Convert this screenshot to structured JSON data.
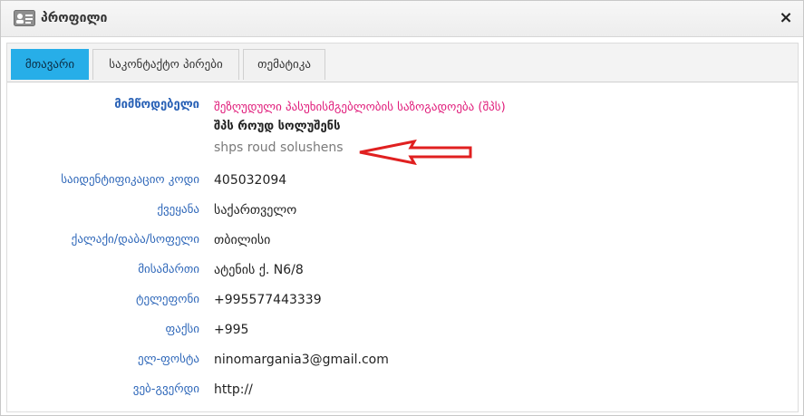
{
  "window": {
    "title": "პროფილი",
    "close": "×"
  },
  "tabs": [
    {
      "label": "მთავარი",
      "active": true
    },
    {
      "label": "საკონტაქტო პირები",
      "active": false
    },
    {
      "label": "თემატიკა",
      "active": false
    }
  ],
  "supplier": {
    "label": "მიმწოდებელი",
    "legal_form": "შეზღუდული პასუხისმგებლობის საზოგადოება (შპს)",
    "name_ka": "შპს როუდ სოლუშენს",
    "name_latin": "shps roud solushens"
  },
  "fields": [
    {
      "label": "საიდენტიფიკაციო კოდი",
      "value": "405032094"
    },
    {
      "label": "ქვეყანა",
      "value": "საქართველო"
    },
    {
      "label": "ქალაქი/დაბა/სოფელი",
      "value": "თბილისი"
    },
    {
      "label": "მისამართი",
      "value": "ატენის ქ. N6/8"
    },
    {
      "label": "ტელეფონი",
      "value": "+995577443339"
    },
    {
      "label": "ფაქსი",
      "value": "+995"
    },
    {
      "label": "ელ-ფოსტა",
      "value": "ninomargania3@gmail.com"
    },
    {
      "label": "ვებ-გვერდი",
      "value": "http://"
    }
  ],
  "colors": {
    "active_tab": "#27aee8",
    "label_blue": "#2e67b9",
    "legal_form_pink": "#e01b7a",
    "arrow_red": "#e02020"
  }
}
